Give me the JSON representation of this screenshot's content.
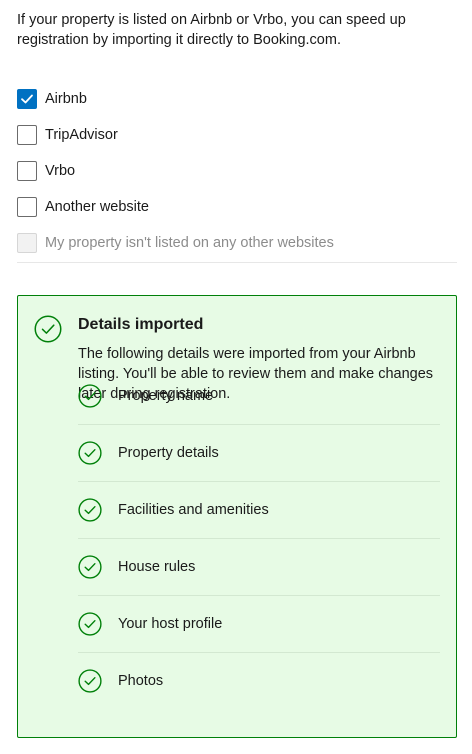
{
  "intro_text": "If your property is listed on Airbnb or Vrbo, you can speed up registration by importing it directly to Booking.com.",
  "options": [
    {
      "label": "Airbnb",
      "checked": true,
      "disabled": false
    },
    {
      "label": "TripAdvisor",
      "checked": false,
      "disabled": false
    },
    {
      "label": "Vrbo",
      "checked": false,
      "disabled": false
    },
    {
      "label": "Another website",
      "checked": false,
      "disabled": false
    },
    {
      "label": "My property isn't listed on any other websites",
      "checked": false,
      "disabled": true
    }
  ],
  "imported_panel": {
    "title": "Details imported",
    "description": "The following details were imported from your Airbnb listing. You'll be able to review them and make changes later during registration.",
    "items": [
      "Property name",
      "Property details",
      "Facilities and amenities",
      "House rules",
      "Your host profile",
      "Photos"
    ]
  },
  "colors": {
    "accent_blue": "#0071c2",
    "success_green": "#008009",
    "panel_bg": "#e7fbe5"
  },
  "icons": {
    "panel": "check-circle-icon",
    "item": "check-circle-icon",
    "checkbox": "checkmark-icon"
  }
}
